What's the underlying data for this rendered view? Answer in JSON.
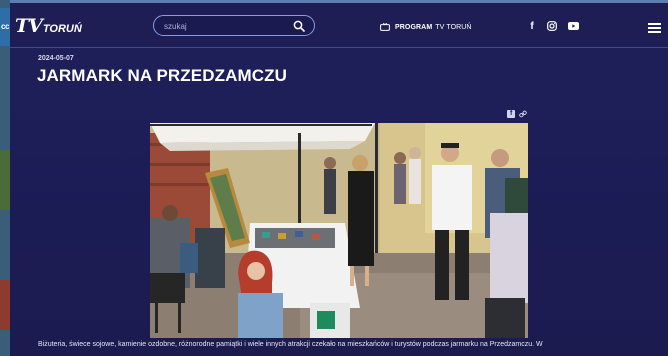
{
  "header": {
    "logo_tv": "TV",
    "logo_city": "TORUŃ",
    "search_placeholder": "szukaj",
    "program_label": "PROGRAM",
    "program_suffix": "TV TORUŃ",
    "social": {
      "facebook": "f",
      "instagram": "instagram-icon",
      "youtube": "youtube-icon"
    },
    "menu_icon": "hamburger-icon"
  },
  "left_tab": {
    "label": "cc"
  },
  "article": {
    "date": "2024-05-07",
    "title": "JARMARK NA PRZEDZAMCZU",
    "share_icons": [
      "facebook-share-icon",
      "link-icon"
    ],
    "photo_alt_icon": "photo",
    "caption": "Biżuteria, świece sojowe, kamienie ozdobne, różnorodne pamiątki i wiele innych atrakcji czekało na mieszkańców i turystów podczas jarmarku na Przedzamczu. W"
  },
  "colors": {
    "background": "#1d1d57",
    "accent": "#3d4aa0",
    "text": "#ffffff"
  }
}
